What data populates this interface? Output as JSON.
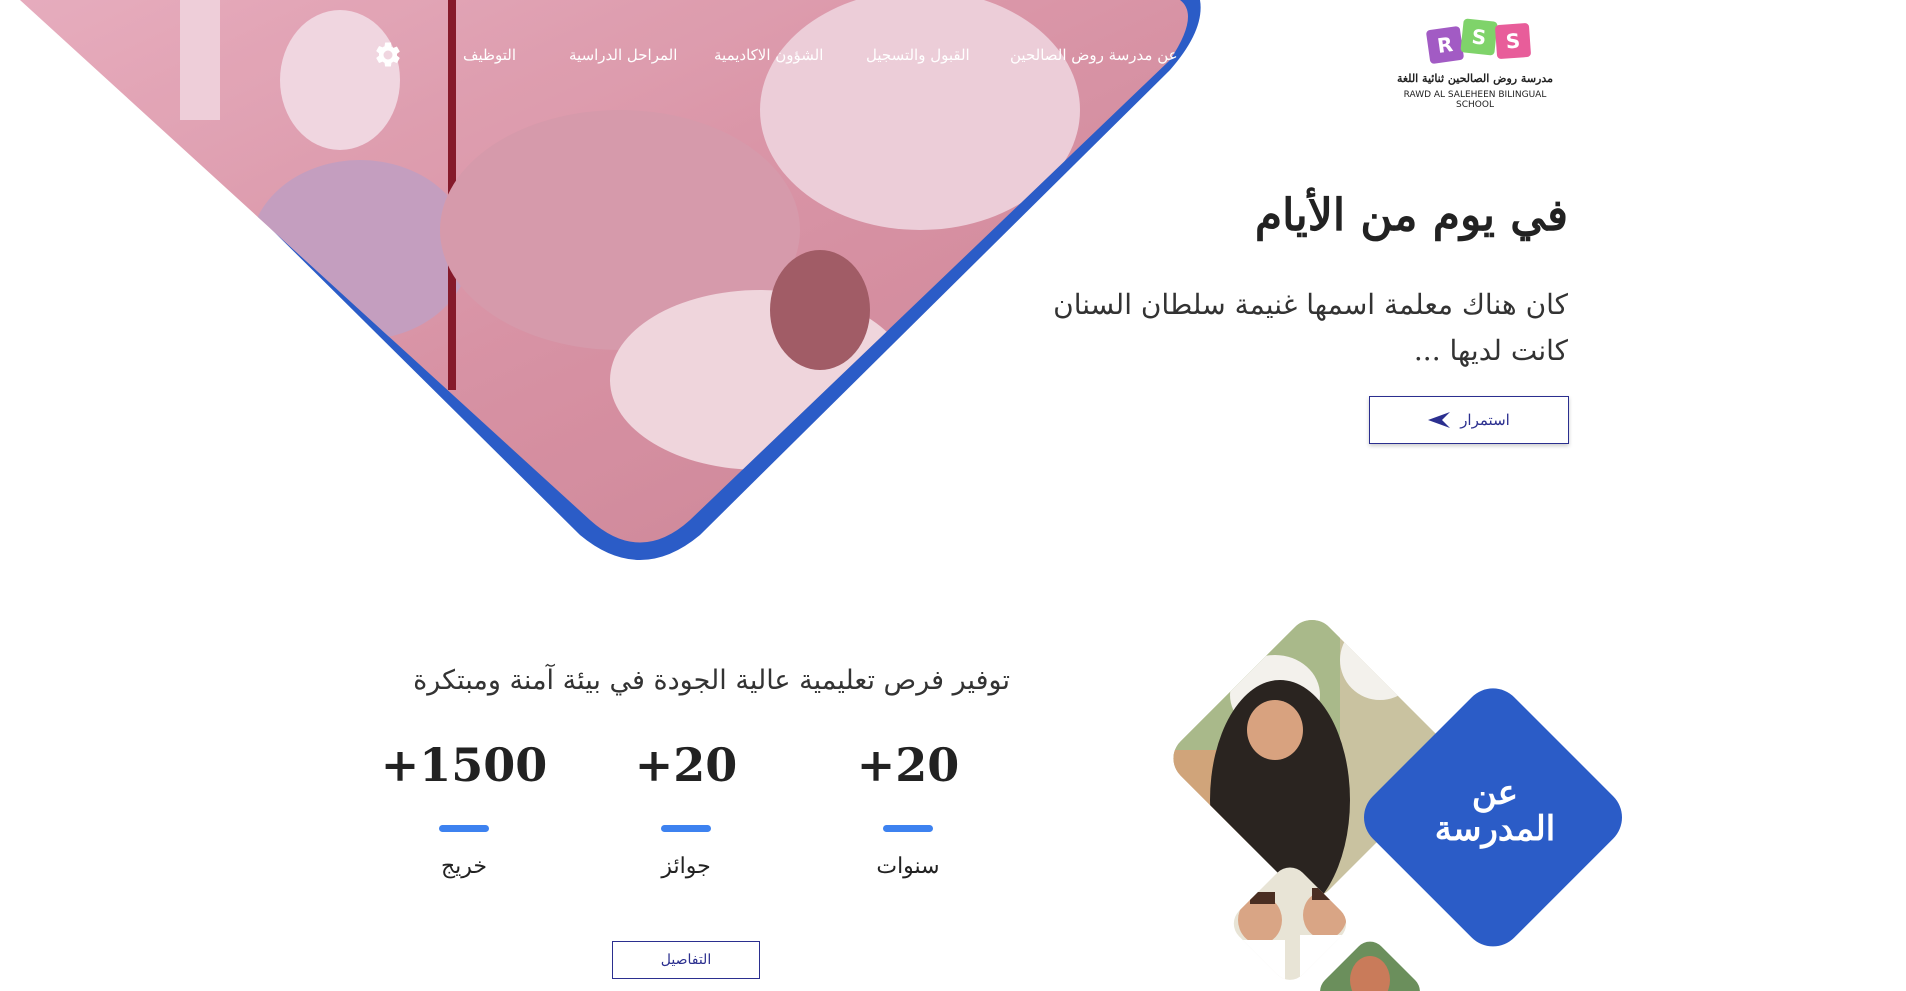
{
  "logo": {
    "letters": [
      "R",
      "S",
      "S"
    ],
    "tile_colors": [
      "#a25bc4",
      "#7fd36a",
      "#e85d9a"
    ],
    "name_ar": "مدرسة روض الصالحين ثنائية اللغة",
    "name_en": "RAWD AL SALEHEEN BILINGUAL SCHOOL"
  },
  "nav": {
    "items": [
      "عن مدرسة روض الصالحين",
      "القبول والتسجيل",
      "الشؤون الاكاديمية",
      "المراحل الدراسية",
      "التوظيف"
    ],
    "settings_icon": "gear-icon"
  },
  "hero": {
    "title": "في يوم من الأيام",
    "subtitle": "كان هناك معلمة اسمها غنيمة سلطان السنان كانت لديها ...",
    "button_label": "استمرار",
    "button_icon": "arrow-left-icon"
  },
  "mission": {
    "text": "توفير فرص تعليمية عالية الجودة في بيئة آمنة ومبتكرة"
  },
  "stats": [
    {
      "value": "+20",
      "label": "سنوات"
    },
    {
      "value": "+20",
      "label": "جوائز"
    },
    {
      "value": "+1500",
      "label": "خريج"
    }
  ],
  "details_button": "التفاصيل",
  "about": {
    "line1": "عن",
    "line2": "المدرسة"
  },
  "colors": {
    "accent_blue": "#2b5cc7",
    "bar_blue": "#3d82f0",
    "button_border": "#2b2f8f"
  }
}
